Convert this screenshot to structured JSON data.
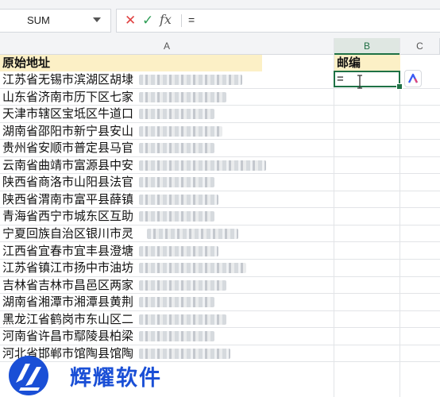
{
  "name_box": {
    "value": "SUM"
  },
  "formula_bar": {
    "cancel_icon": "✕",
    "confirm_icon": "✓",
    "fx_label": "fx",
    "content": "="
  },
  "columns": [
    "A",
    "B",
    "C"
  ],
  "sheet": {
    "header": {
      "a": "原始地址",
      "b": "邮编"
    },
    "rows": [
      "江苏省无锡市滨湖区胡埭",
      "山东省济南市历下区七家",
      "天津市辖区宝坻区牛道口",
      "湖南省邵阳市新宁县安山",
      "贵州省安顺市普定县马官",
      "云南省曲靖市富源县中安",
      "陕西省商洛市山阳县法官",
      "陕西省渭南市富平县薛镇",
      "青海省西宁市城东区互助",
      "宁夏回族自治区银川市灵",
      "江西省宜春市宜丰县澄塘",
      "江苏省镇江市扬中市油坊",
      "吉林省吉林市昌邑区两家",
      "湖南省湘潭市湘潭县黄荆",
      "黑龙江省鹤岗市东山区二",
      "河南省许昌市鄢陵县柏梁",
      "河北省邯郸市馆陶县馆陶"
    ],
    "active_cell_value": "="
  },
  "watermark": {
    "brand_text": "辉耀软件"
  },
  "colors": {
    "accent_green": "#1e7145",
    "header_fill": "#fcf0c6",
    "logo_blue": "#1a4fd6"
  }
}
